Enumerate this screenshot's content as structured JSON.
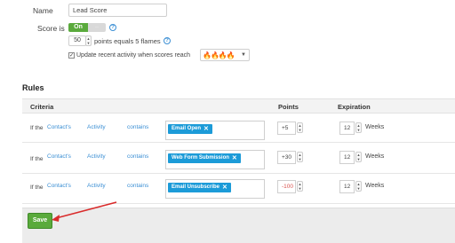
{
  "form": {
    "name_label": "Name",
    "name_value": "Lead Score",
    "score_label": "Score is",
    "toggle_on": "On",
    "toggle_off": "··",
    "points_value": "50",
    "points_text": "points equals 5 flames",
    "update_text": "Update recent activity when scores reach",
    "update_checked": true,
    "flame_select_value": "🔥🔥🔥🔥"
  },
  "rules": {
    "title": "Rules",
    "columns": {
      "criteria": "Criteria",
      "points": "Points",
      "expiration": "Expiration"
    },
    "rows": [
      {
        "if": "If the",
        "object": "Contact's",
        "field": "Activity",
        "op": "contains",
        "tag": "Email Open",
        "points": "+5",
        "exp": "12",
        "unit": "Weeks",
        "negative": false
      },
      {
        "if": "If the",
        "object": "Contact's",
        "field": "Activity",
        "op": "contains",
        "tag": "Web Form Submission",
        "points": "+30",
        "exp": "12",
        "unit": "Weeks",
        "negative": false
      },
      {
        "if": "If the",
        "object": "Contact's",
        "field": "Activity",
        "op": "contains",
        "tag": "Email Unsubscribe",
        "points": "-100",
        "exp": "12",
        "unit": "Weeks",
        "negative": true
      }
    ]
  },
  "footer": {
    "save_label": "Save"
  },
  "colors": {
    "accent_green": "#5aaa3c",
    "tag_blue": "#1c9bd8",
    "link_blue": "#3b8fd4",
    "negative_red": "#d9534f",
    "annotation_red": "#d92b2b"
  }
}
